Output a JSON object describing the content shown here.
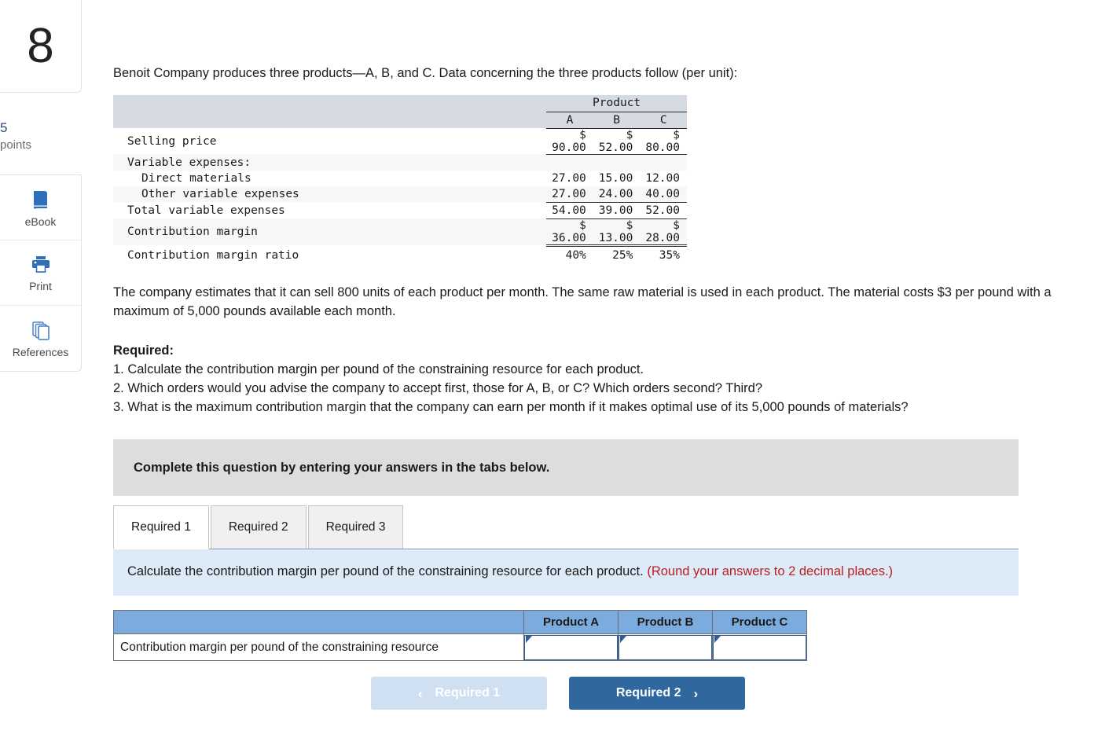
{
  "sidebar": {
    "question_number": "8",
    "points_value": "5",
    "points_label": "points",
    "tools": [
      {
        "label": "eBook",
        "icon": "book-icon"
      },
      {
        "label": "Print",
        "icon": "printer-icon"
      },
      {
        "label": "References",
        "icon": "references-icon"
      }
    ]
  },
  "question": {
    "intro": "Benoit Company produces three products—A, B, and C. Data concerning the three products follow (per unit):",
    "paragraph": "The company estimates that it can sell 800 units of each product per month. The same raw material is used in each product. The material costs $3 per pound with a maximum of 5,000 pounds available each month.",
    "required_heading": "Required:",
    "required_items": [
      "1. Calculate the contribution margin per pound of the constraining resource for each product.",
      "2. Which orders would you advise the company to accept first, those for A, B, or C? Which orders second? Third?",
      "3. What is the maximum contribution margin that the company can earn per month if it makes optimal use of its 5,000 pounds of materials?"
    ]
  },
  "data_table": {
    "group_header": "Product",
    "columns": [
      "A",
      "B",
      "C"
    ],
    "rows": [
      {
        "label": "Selling price",
        "values": [
          "$ 90.00",
          "$ 52.00",
          "$ 80.00"
        ]
      },
      {
        "label": "Variable expenses:",
        "values": [
          "",
          "",
          ""
        ]
      },
      {
        "label": "Direct materials",
        "values": [
          "27.00",
          "15.00",
          "12.00"
        ]
      },
      {
        "label": "Other variable expenses",
        "values": [
          "27.00",
          "24.00",
          "40.00"
        ]
      },
      {
        "label": "Total variable expenses",
        "values": [
          "54.00",
          "39.00",
          "52.00"
        ]
      },
      {
        "label": "Contribution margin",
        "values": [
          "$ 36.00",
          "$ 13.00",
          "$ 28.00"
        ]
      },
      {
        "label": "Contribution margin ratio",
        "values": [
          "40%",
          "25%",
          "35%"
        ]
      }
    ]
  },
  "banner": {
    "text": "Complete this question by entering your answers in the tabs below."
  },
  "tabs": [
    {
      "label": "Required 1"
    },
    {
      "label": "Required 2"
    },
    {
      "label": "Required 3"
    }
  ],
  "instruction": {
    "main": "Calculate the contribution margin per pound of the constraining resource for each product.",
    "hint": "(Round your answers to 2 decimal places.)"
  },
  "answer_table": {
    "headers": [
      "",
      "Product A",
      "Product B",
      "Product C"
    ],
    "row_label": "Contribution margin per pound of the constraining resource",
    "values": [
      "",
      "",
      ""
    ]
  },
  "navigation": {
    "prev_label": "Required 1",
    "next_label": "Required 2",
    "prev_chevron": "‹",
    "next_chevron": "›"
  },
  "colors": {
    "accent_blue": "#30679f",
    "table_header_blue": "#7cacdd",
    "instruction_bg": "#ddeaf8",
    "hint_red": "#bc1f1f",
    "banner_gray": "#dddddd",
    "data_header_gray": "#d5dae3"
  }
}
